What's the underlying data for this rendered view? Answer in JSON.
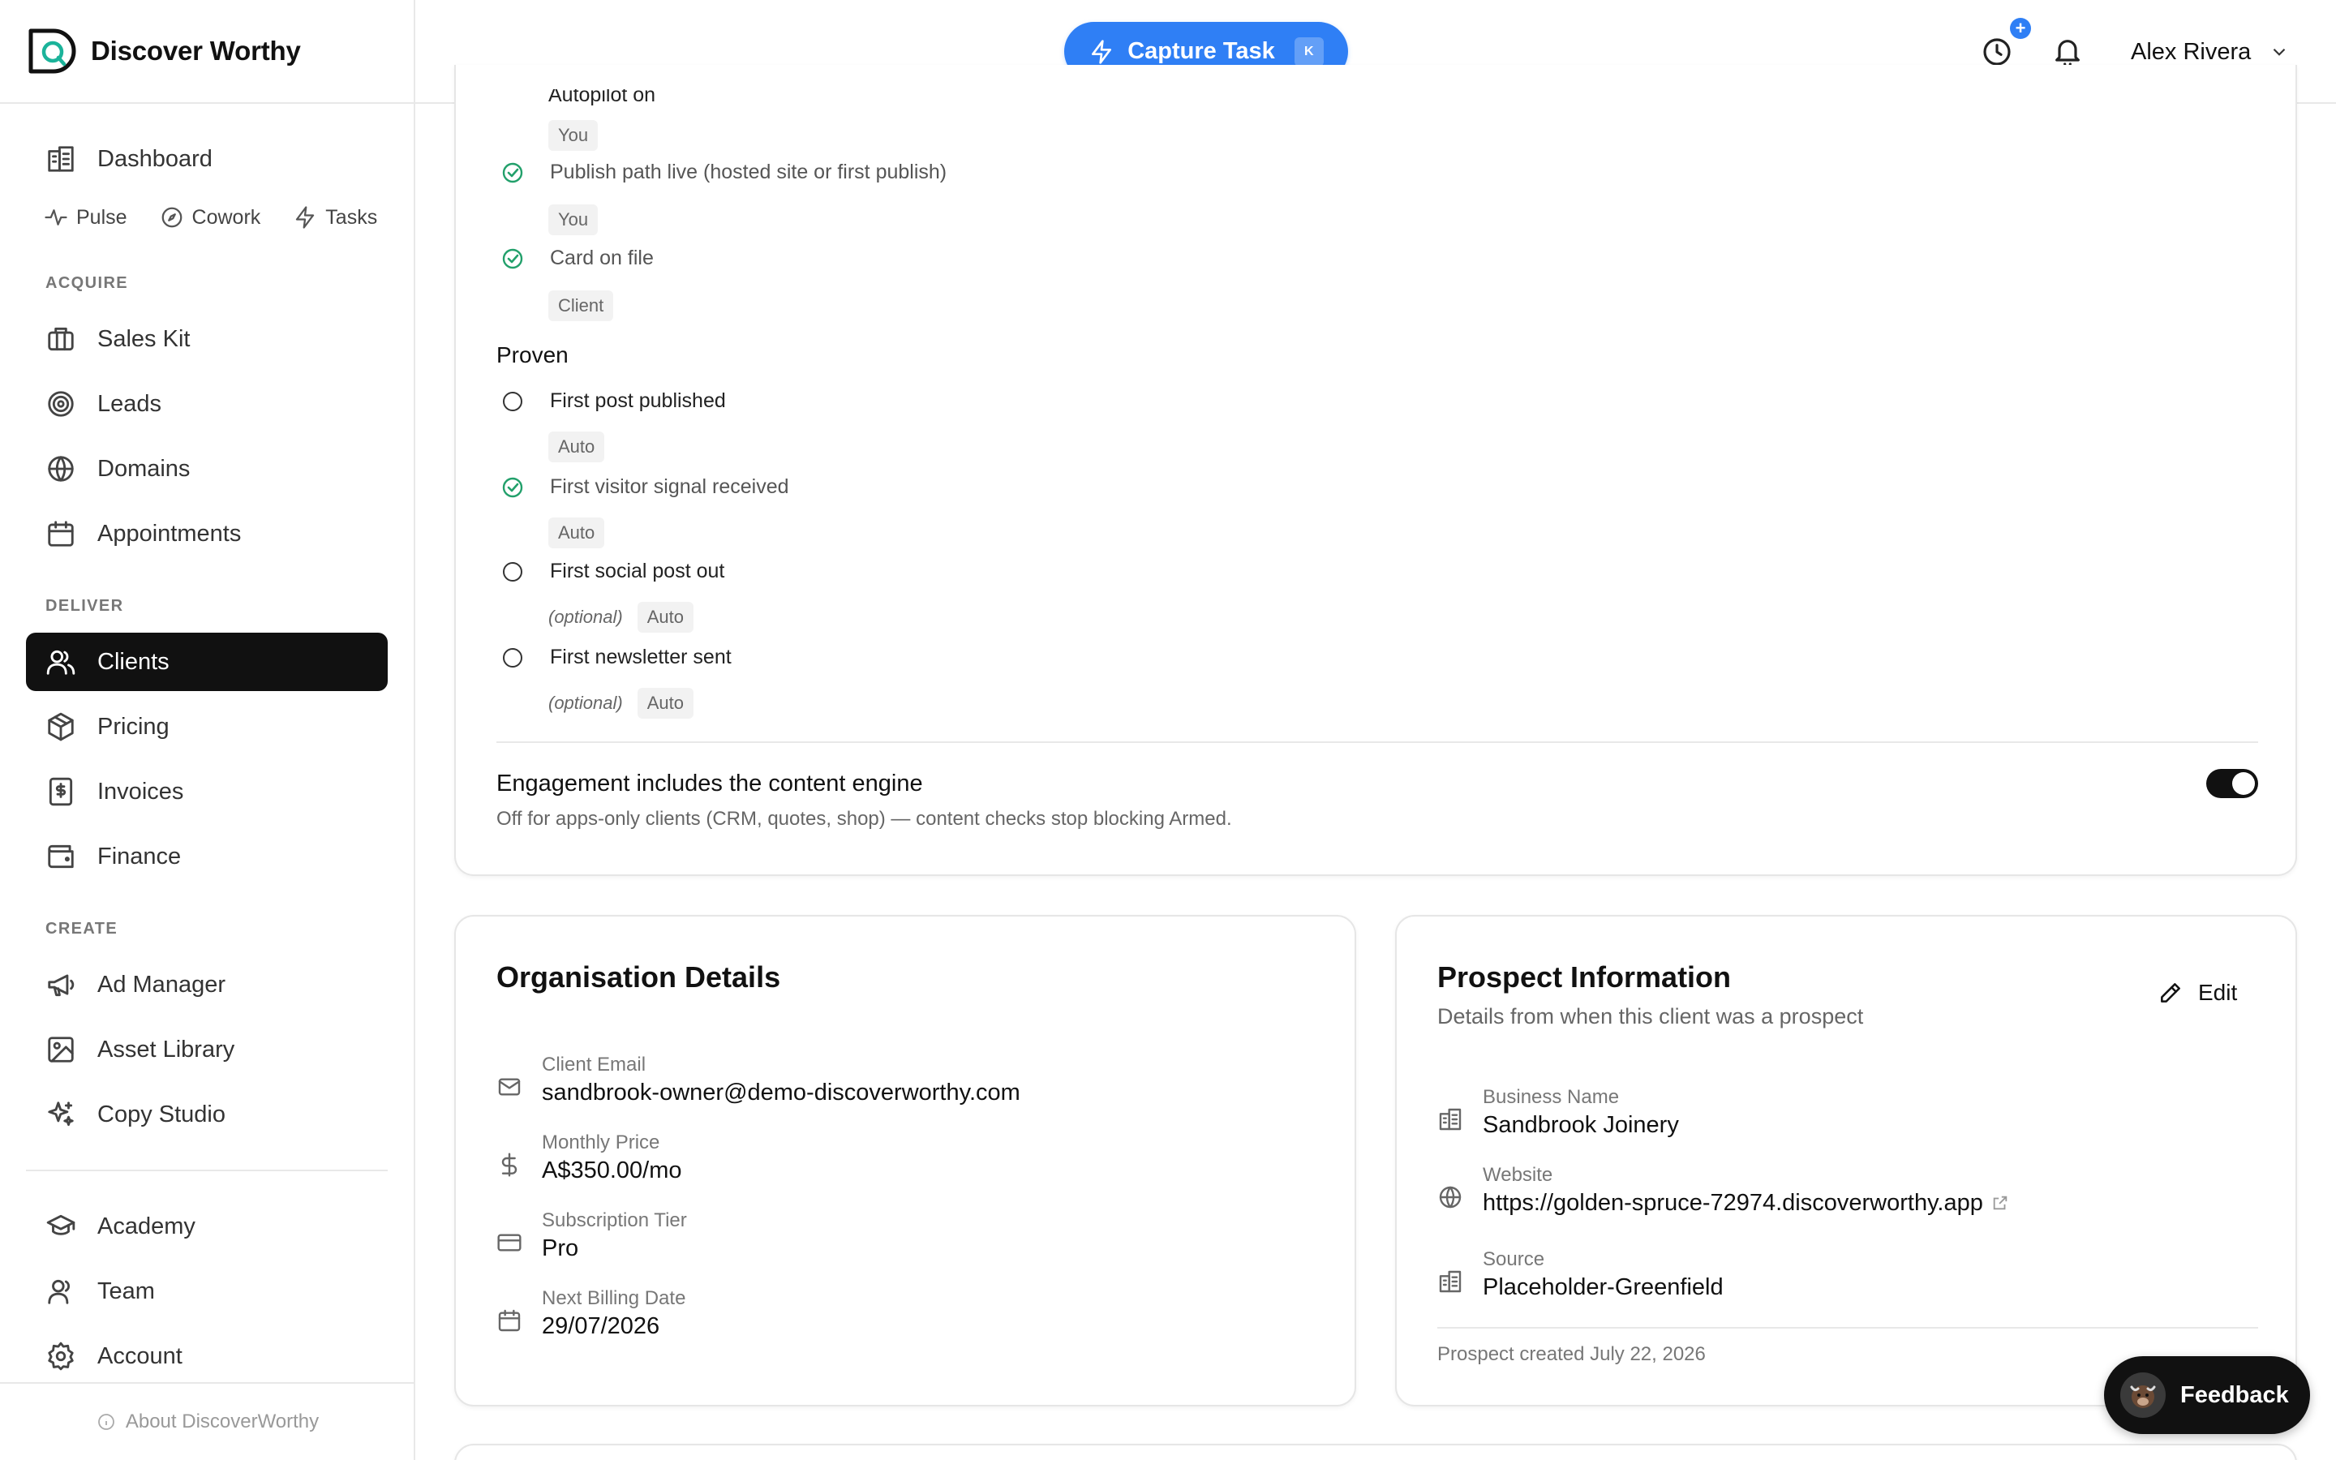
{
  "brand": {
    "name": "Discover Worthy"
  },
  "sidebar": {
    "primary": {
      "label": "Dashboard"
    },
    "quick": [
      {
        "label": "Pulse",
        "icon": "pulse-icon"
      },
      {
        "label": "Cowork",
        "icon": "compass-icon"
      },
      {
        "label": "Tasks",
        "icon": "bolt-icon"
      }
    ],
    "sections": {
      "acquire": "ACQUIRE",
      "deliver": "DELIVER",
      "create": "CREATE"
    },
    "items": [
      {
        "label": "Sales Kit",
        "icon": "briefcase-icon"
      },
      {
        "label": "Leads",
        "icon": "target-icon"
      },
      {
        "label": "Domains",
        "icon": "globe-icon"
      },
      {
        "label": "Appointments",
        "icon": "calendar-icon"
      },
      {
        "label": "Clients",
        "icon": "users-icon",
        "active": true
      },
      {
        "label": "Pricing",
        "icon": "package-icon"
      },
      {
        "label": "Invoices",
        "icon": "invoice-icon"
      },
      {
        "label": "Finance",
        "icon": "wallet-icon"
      },
      {
        "label": "Ad Manager",
        "icon": "megaphone-icon"
      },
      {
        "label": "Asset Library",
        "icon": "image-icon"
      },
      {
        "label": "Copy Studio",
        "icon": "sparkles-icon"
      },
      {
        "label": "Academy",
        "icon": "graduation-cap-icon"
      },
      {
        "label": "Team",
        "icon": "user-icon"
      },
      {
        "label": "Account",
        "icon": "gear-icon"
      }
    ],
    "about": "About DiscoverWorthy"
  },
  "topbar": {
    "capture_label": "Capture Task",
    "capture_shortcut": "K",
    "user_name": "Alex Rivera",
    "badge": "+"
  },
  "checklist": {
    "clipped_label": "Autopilot on",
    "armed_items": [
      {
        "owner": "You"
      },
      {
        "label": "Publish path live (hosted site or first publish)",
        "owner": "You",
        "done": true
      },
      {
        "label": "Card on file",
        "owner": "Client",
        "done": true
      }
    ],
    "proven_title": "Proven",
    "proven_items": [
      {
        "label": "First post published",
        "owner": "Auto",
        "done": false
      },
      {
        "label": "First visitor signal received",
        "owner": "Auto",
        "done": true
      },
      {
        "label": "First social post out",
        "owner": "Auto",
        "optional": "(optional)",
        "done": false
      },
      {
        "label": "First newsletter sent",
        "owner": "Auto",
        "optional": "(optional)",
        "done": false
      }
    ],
    "engine_title": "Engagement includes the content engine",
    "engine_desc": "Off for apps-only clients (CRM, quotes, shop) — content checks stop blocking Armed.",
    "engine_enabled": true
  },
  "org": {
    "title": "Organisation Details",
    "fields": [
      {
        "label": "Client Email",
        "value": "sandbrook-owner@demo-discoverworthy.com",
        "icon": "mail-icon"
      },
      {
        "label": "Monthly Price",
        "value": "A$350.00/mo",
        "icon": "dollar-icon"
      },
      {
        "label": "Subscription Tier",
        "value": "Pro",
        "icon": "credit-card-icon"
      },
      {
        "label": "Next Billing Date",
        "value": "29/07/2026",
        "icon": "calendar-icon"
      }
    ]
  },
  "prospect": {
    "title": "Prospect Information",
    "subtitle": "Details from when this client was a prospect",
    "edit_label": "Edit",
    "fields": [
      {
        "label": "Business Name",
        "value": "Sandbrook Joinery",
        "icon": "building-icon"
      },
      {
        "label": "Website",
        "value": "https://golden-spruce-72974.discoverworthy.app",
        "icon": "globe-icon"
      },
      {
        "label": "Source",
        "value": "Placeholder-Greenfield",
        "icon": "building-icon"
      }
    ],
    "footer": "Prospect created July 22, 2026"
  },
  "feedback": {
    "label": "Feedback"
  },
  "colors": {
    "accent": "#2f7ff5",
    "success": "#22a06b",
    "active_nav": "#111111"
  }
}
